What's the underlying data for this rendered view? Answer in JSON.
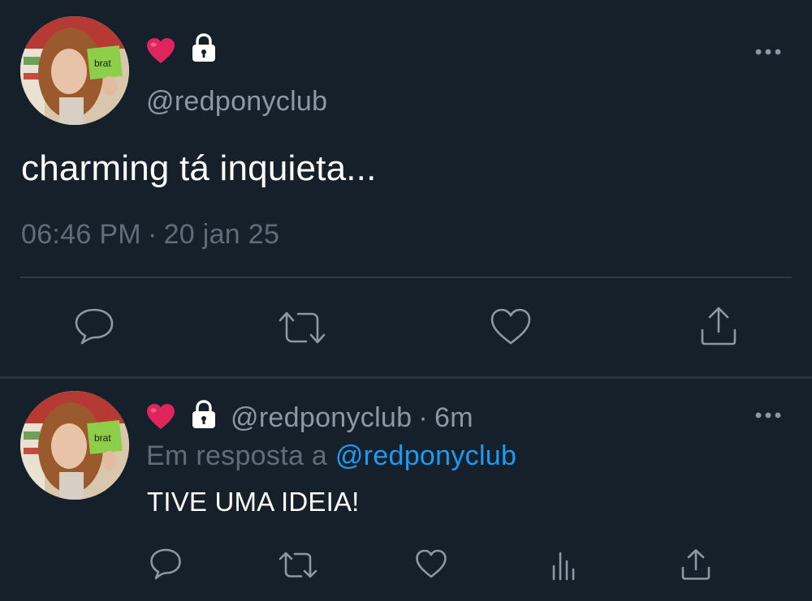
{
  "main_tweet": {
    "handle": "@redponyclub",
    "text": "charming tá inquieta...",
    "time": "06:46 PM",
    "separator": "·",
    "date": "20 jan 25"
  },
  "reply_tweet": {
    "handle": "@redponyclub",
    "dot": "·",
    "age": "6m",
    "replying_prefix": "Em resposta a",
    "replying_to": "@redponyclub",
    "text": "TIVE UMA IDEIA!"
  },
  "avatar_album_text": "brat",
  "icons": {
    "name_emoji": "red-heart",
    "protected": "lock",
    "more": "ellipsis",
    "actions_main": [
      "reply",
      "retweet",
      "like",
      "share"
    ],
    "actions_reply": [
      "reply",
      "retweet",
      "like",
      "analytics",
      "share"
    ]
  },
  "colors": {
    "background": "#15202b",
    "text": "#ffffff",
    "secondary": "#8b98a5",
    "link": "#1d9bf0",
    "heart": "#e0245e"
  }
}
